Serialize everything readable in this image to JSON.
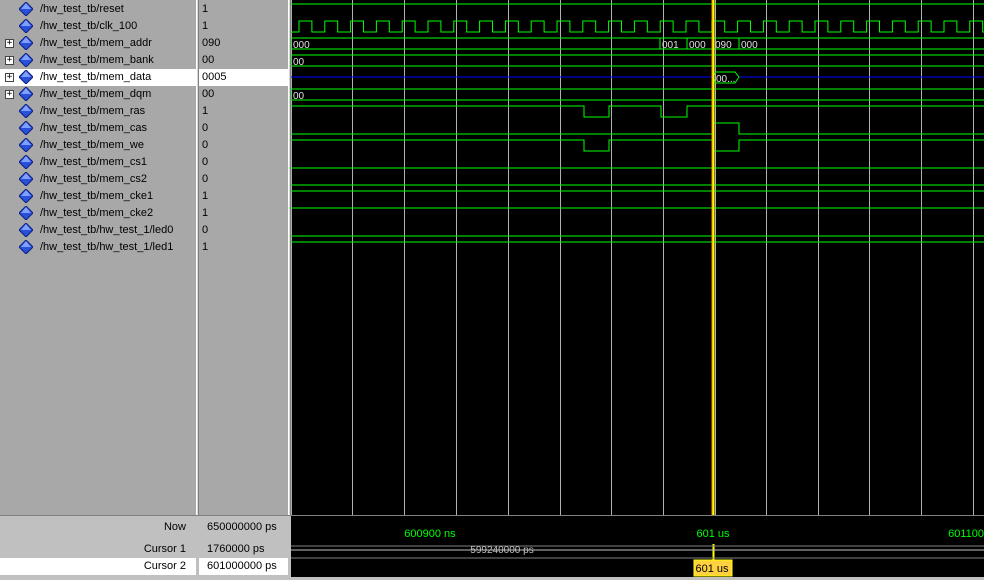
{
  "signals": [
    {
      "name": "/hw_test_tb/reset",
      "value": "1",
      "expandable": false
    },
    {
      "name": "/hw_test_tb/clk_100",
      "value": "1",
      "expandable": false
    },
    {
      "name": "/hw_test_tb/mem_addr",
      "value": "090",
      "expandable": true
    },
    {
      "name": "/hw_test_tb/mem_bank",
      "value": "00",
      "expandable": true
    },
    {
      "name": "/hw_test_tb/mem_data",
      "value": "0005",
      "expandable": true,
      "selected": true
    },
    {
      "name": "/hw_test_tb/mem_dqm",
      "value": "00",
      "expandable": true
    },
    {
      "name": "/hw_test_tb/mem_ras",
      "value": "1",
      "expandable": false
    },
    {
      "name": "/hw_test_tb/mem_cas",
      "value": "0",
      "expandable": false
    },
    {
      "name": "/hw_test_tb/mem_we",
      "value": "0",
      "expandable": false
    },
    {
      "name": "/hw_test_tb/mem_cs1",
      "value": "0",
      "expandable": false
    },
    {
      "name": "/hw_test_tb/mem_cs2",
      "value": "0",
      "expandable": false
    },
    {
      "name": "/hw_test_tb/mem_cke1",
      "value": "1",
      "expandable": false
    },
    {
      "name": "/hw_test_tb/mem_cke2",
      "value": "1",
      "expandable": false
    },
    {
      "name": "/hw_test_tb/hw_test_1/led0",
      "value": "0",
      "expandable": false
    },
    {
      "name": "/hw_test_tb/hw_test_1/led1",
      "value": "1",
      "expandable": false
    }
  ],
  "bus_labels": {
    "mem_addr": [
      "000",
      "001",
      "000",
      "090",
      "000"
    ],
    "mem_bank": [
      "00"
    ],
    "mem_data": [
      "00..."
    ],
    "mem_dqm": [
      "00"
    ]
  },
  "icons": {
    "signal": "blue-diamond-icon",
    "expand": "plus-box-icon"
  },
  "colors": {
    "wave": "#00ff00",
    "bus_z": "#0000ff",
    "cursor": "#ffff00",
    "cursor_edge": "#ff8000",
    "bg": "#000000",
    "panel": "#a8a8a8"
  },
  "bottom": {
    "now_label": "Now",
    "now_value": "650000000 ps",
    "cursor1_label": "Cursor 1",
    "cursor1_value": "1760000 ps",
    "cursor2_label": "Cursor 2",
    "cursor2_value": "601000000 ps",
    "tick_labels": [
      "600900 ns",
      "601 us",
      "601100"
    ],
    "delta_label": "599240000 ps",
    "cursor_badge": "601 us"
  }
}
